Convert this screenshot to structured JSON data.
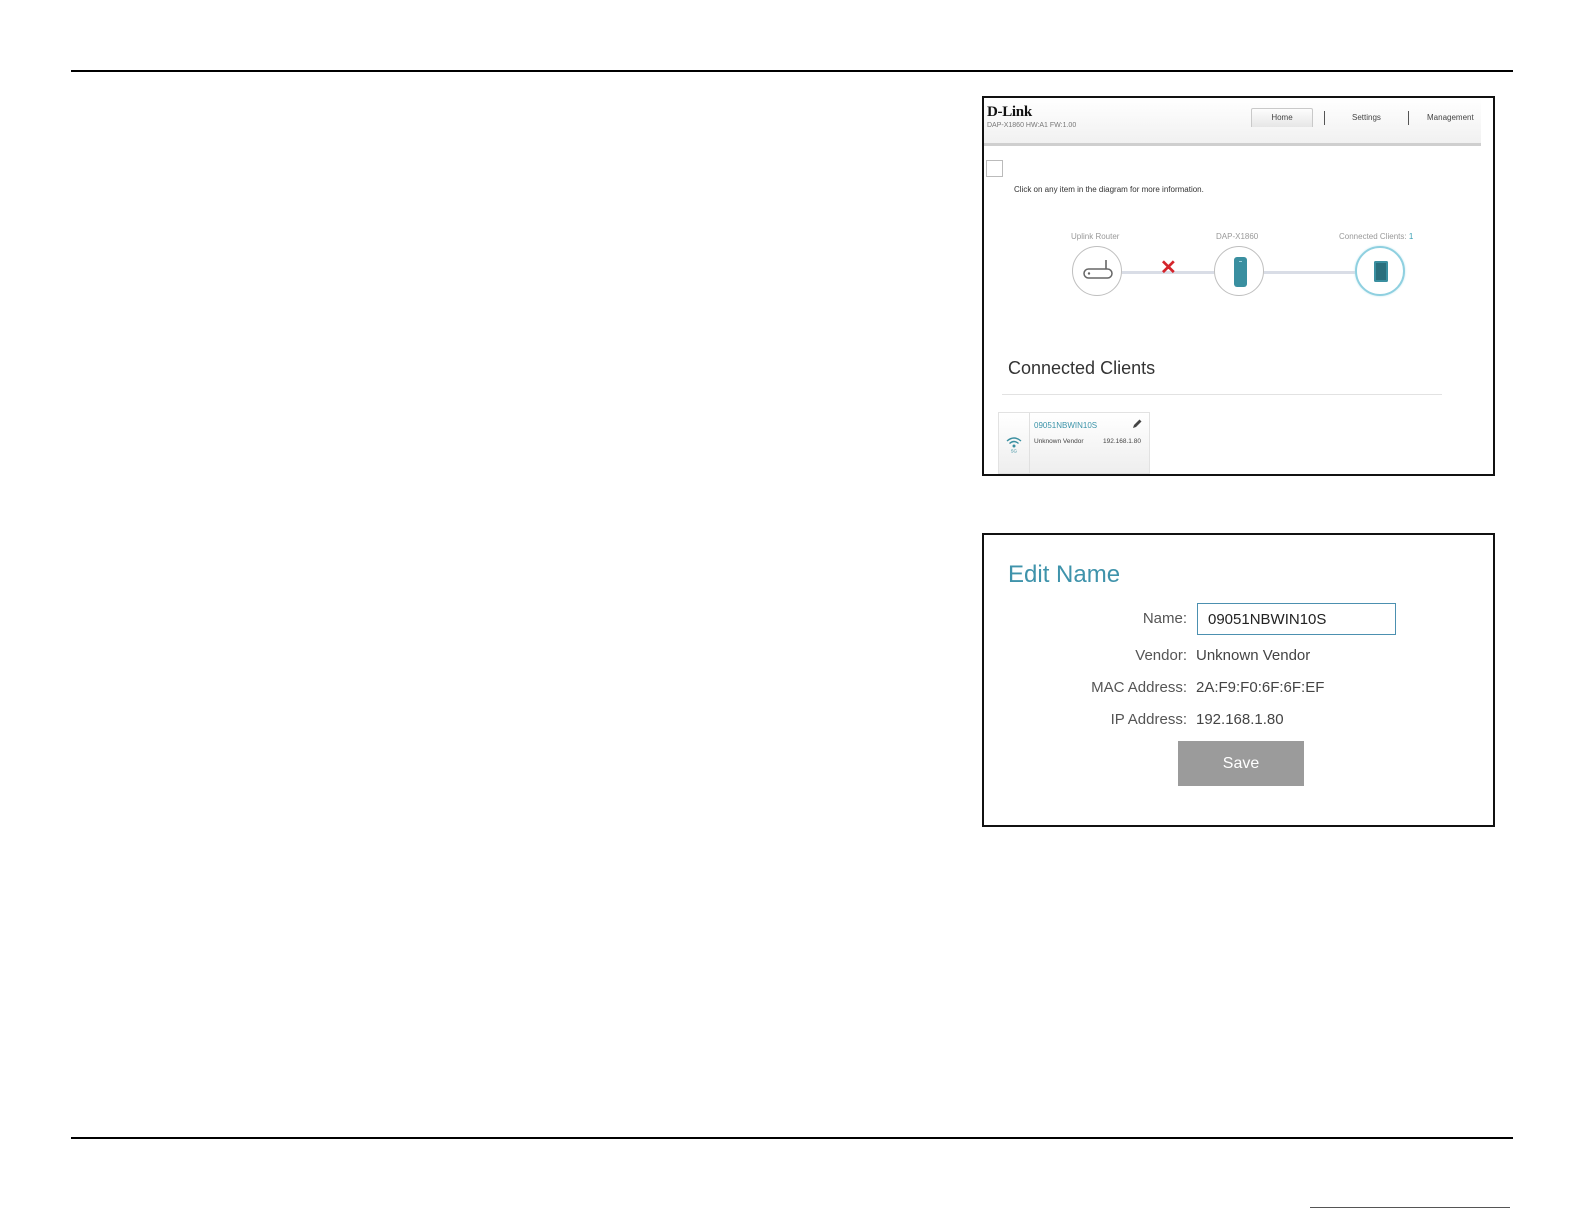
{
  "home_screenshot": {
    "brand": "D-Link",
    "device_info": "DAP-X1860 HW:A1 FW:1.00",
    "nav": {
      "home": "Home",
      "settings": "Settings",
      "management": "Management"
    },
    "hint": "Click on any item in the diagram for more information.",
    "diagram": {
      "uplink_label": "Uplink Router",
      "device_label": "DAP-X1860",
      "clients_label": "Connected Clients:",
      "clients_count": "1",
      "uplink_status": "disconnected"
    },
    "section_title": "Connected Clients",
    "client": {
      "name": "09051NBWIN10S",
      "vendor": "Unknown Vendor",
      "ip": "192.168.1.80",
      "band": "5G"
    }
  },
  "edit_screenshot": {
    "title": "Edit Name",
    "fields": {
      "name_label": "Name:",
      "name_value": "09051NBWIN10S",
      "vendor_label": "Vendor:",
      "vendor_value": "Unknown Vendor",
      "mac_label": "MAC Address:",
      "mac_value": "2A:F9:F0:6F:6F:EF",
      "ip_label": "IP Address:",
      "ip_value": "192.168.1.80"
    },
    "save_label": "Save"
  },
  "colors": {
    "accent": "#3f93ab",
    "device_teal": "#3a8fa0",
    "error_red": "#d4242b",
    "button_gray": "#9b9b9b"
  }
}
